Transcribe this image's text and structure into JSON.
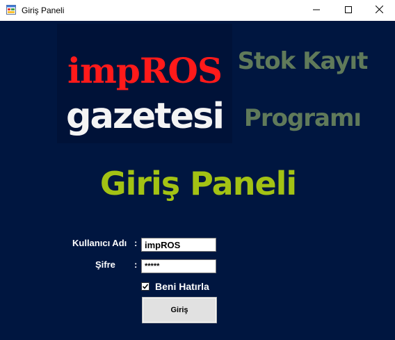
{
  "window": {
    "title": "Giriş Paneli",
    "icons": {
      "app": "app-form-icon",
      "minimize": "minimize-icon",
      "maximize": "maximize-icon",
      "close": "close-icon"
    }
  },
  "banner": {
    "line1": "impROS",
    "line2": "gazetesi"
  },
  "heading": {
    "line1": "Stok Kayıt",
    "line2": "Programı",
    "title": "Giriş Paneli"
  },
  "form": {
    "username_label": "Kullanıcı Adı",
    "username_value": "impROS",
    "password_label": "Şifre",
    "password_value": "*****",
    "colon": ":",
    "remember_label": "Beni Hatırla",
    "remember_checked": true,
    "login_label": "Giriş"
  },
  "colors": {
    "background": "#001640",
    "banner_red": "#ff1a1a",
    "heading_green": "#a3c214",
    "subtitle_gray_green": "#607a5a"
  }
}
